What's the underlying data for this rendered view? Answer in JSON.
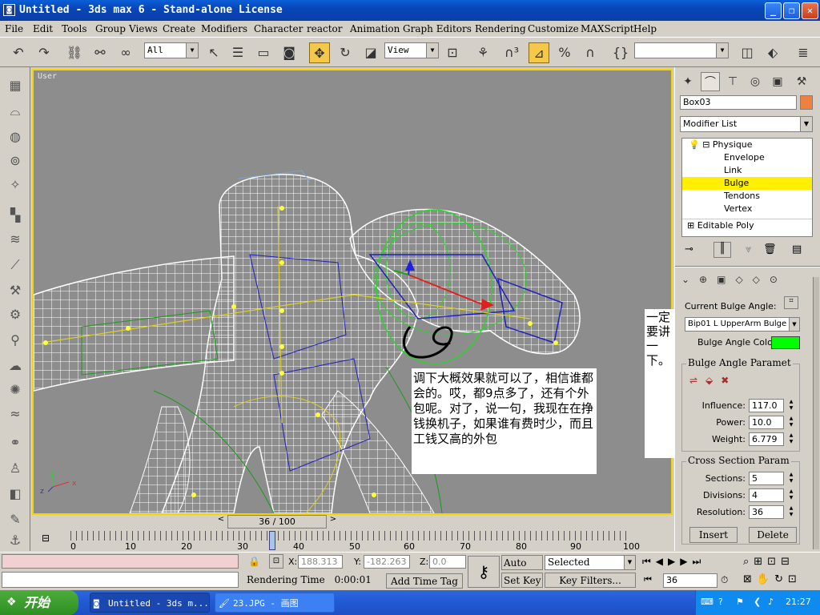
{
  "window": {
    "title": "Untitled - 3ds max 6 - Stand-alone License",
    "app_icon": "max-icon"
  },
  "menu": [
    "File",
    "Edit",
    "Tools",
    "Group",
    "Views",
    "Create",
    "Modifiers",
    "Character",
    "reactor",
    "Animation",
    "Graph Editors",
    "Rendering",
    "Customize",
    "MAXScript",
    "Help"
  ],
  "toolbar": {
    "selection_filter": "All",
    "reference_coord": "View",
    "named_selection": ""
  },
  "viewport": {
    "label": "User"
  },
  "notes": {
    "main": "调下大概效果就可以了，相信谁都会的。哎，都9点多了，还有个外包呢。对了，说一句，我现在在挣钱换机子，如果谁有费时少，而且工钱又高的外包",
    "side": "一定要讲一下。"
  },
  "panel": {
    "object_name": "Box03",
    "object_color": "#f08040",
    "modifier_list": "Modifier List",
    "stack": {
      "physique": "Physique",
      "envelope": "Envelope",
      "link": "Link",
      "bulge": "Bulge",
      "tendons": "Tendons",
      "vertex": "Vertex",
      "editable_poly": "Editable Poly"
    },
    "current_bulge_angle_label": "Current Bulge Angle:",
    "current_bulge_angle": "Bip01 L UpperArm Bulge (",
    "bulge_angle_color_label": "Bulge Angle Color:",
    "bulge_angle_color": "#00ff00",
    "bulge_params_title": "Bulge Angle Paramet",
    "influence_label": "Influence:",
    "influence": "117.0",
    "power_label": "Power:",
    "power": "10.0",
    "weight_label": "Weight:",
    "weight": "6.779",
    "cross_section_title": "Cross Section Param",
    "sections_label": "Sections:",
    "sections": "5",
    "divisions_label": "Divisions:",
    "divisions": "4",
    "resolution_label": "Resolution:",
    "resolution": "36",
    "insert": "Insert",
    "delete": "Delete"
  },
  "timeline": {
    "frame_display": "36 / 100",
    "ticks": [
      "0",
      "10",
      "20",
      "30",
      "40",
      "50",
      "60",
      "70",
      "80",
      "90",
      "100"
    ],
    "current_frame": 36,
    "max_frame": 100
  },
  "status": {
    "x_label": "X:",
    "x": "188.313",
    "y_label": "Y:",
    "y": "-182.263",
    "z_label": "Z:",
    "z": "0.0",
    "rendering_time_label": "Rendering Time",
    "rendering_time": "0:00:01",
    "add_time_tag": "Add Time Tag",
    "auto_key": "Auto Key",
    "set_key": "Set Key",
    "key_mode": "Selected",
    "key_filters": "Key Filters...",
    "frame_field": "36"
  },
  "taskbar": {
    "start": "开始",
    "tasks": [
      "Untitled - 3ds m...",
      "23.JPG - 画图"
    ],
    "clock": "21:27"
  }
}
